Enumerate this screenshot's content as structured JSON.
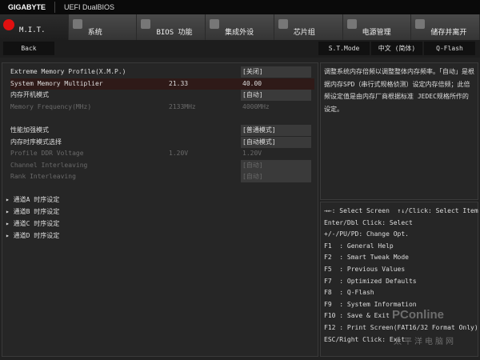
{
  "header": {
    "brand": "GIGABYTE",
    "title": "UEFI DualBIOS"
  },
  "tabs": [
    {
      "label": "M.I.T.",
      "icon": "mit-icon"
    },
    {
      "label": "系统",
      "icon": "gear-icon"
    },
    {
      "label": "BIOS 功能",
      "icon": "bios-icon"
    },
    {
      "label": "集成外设",
      "icon": "peripherals-icon"
    },
    {
      "label": "芯片组",
      "icon": "chipset-icon"
    },
    {
      "label": "电源管理",
      "icon": "power-icon"
    },
    {
      "label": "储存并离开",
      "icon": "exit-icon"
    }
  ],
  "subbar": {
    "back": "Back",
    "st_mode": "S.T.Mode",
    "language": "中文 (简体)",
    "qflash": "Q-Flash"
  },
  "settings": [
    {
      "name": "Extreme Memory Profile(X.M.P.)",
      "current": "",
      "value": "[关闭]"
    },
    {
      "name": "System Memory Multiplier",
      "current": "21.33",
      "value": "40.00"
    },
    {
      "name": "内存开机模式",
      "current": "",
      "value": "[自动]"
    },
    {
      "name": "Memory Frequency(MHz)",
      "current": "2133MHz",
      "value": "4000MHz"
    },
    {
      "name": "性能加强模式",
      "current": "",
      "value": "[普通模式]"
    },
    {
      "name": "内存时序模式选择",
      "current": "",
      "value": "[自动模式]"
    },
    {
      "name": "Profile DDR Voltage",
      "current": "1.20V",
      "value": "1.20V"
    },
    {
      "name": "Channel Interleaving",
      "current": "",
      "value": "[自动]"
    },
    {
      "name": "Rank Interleaving",
      "current": "",
      "value": "[自动]"
    }
  ],
  "groups": [
    "通道A 时序设定",
    "通道B 时序设定",
    "通道C 时序设定",
    "通道D 时序设定"
  ],
  "help": "调整系统内存倍频以调整整体内存频率。「自动」是根据内存SPD（串行式规格侦测）设定内存倍频；此倍频设定值是由内存厂商根据标准 JEDEC规格所作的设定。",
  "keys": [
    "→←: Select Screen  ↑↓/Click: Select Item",
    "Enter/Dbl Click: Select",
    "+/-/PU/PD: Change Opt.",
    "F1  : General Help",
    "F2  : Smart Tweak Mode",
    "F5  : Previous Values",
    "F7  : Optimized Defaults",
    "F8  : Q-Flash",
    "F9  : System Information",
    "F10 : Save & Exit",
    "F12 : Print Screen(FAT16/32 Format Only)",
    "ESC/Right Click: Exit"
  ],
  "watermark": {
    "brand": "PConline",
    "cn": "太平洋电脑网"
  }
}
